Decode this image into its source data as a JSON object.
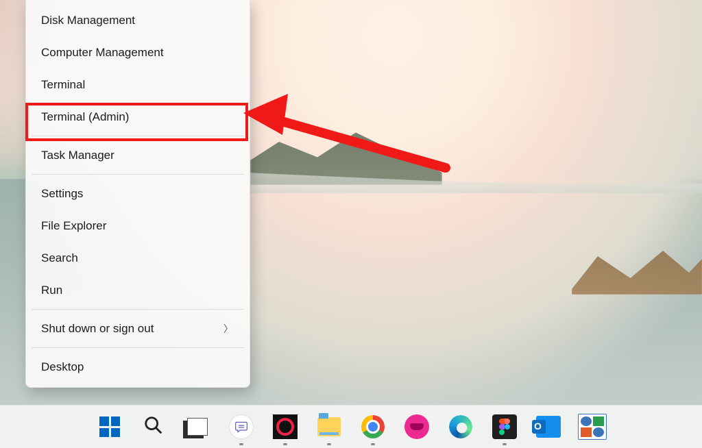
{
  "menu": {
    "items": [
      {
        "label": "Disk Management",
        "submenu": false,
        "highlighted": false,
        "sep_after": false
      },
      {
        "label": "Computer Management",
        "submenu": false,
        "highlighted": false,
        "sep_after": false
      },
      {
        "label": "Terminal",
        "submenu": false,
        "highlighted": false,
        "sep_after": false
      },
      {
        "label": "Terminal (Admin)",
        "submenu": false,
        "highlighted": true,
        "sep_after": true
      },
      {
        "label": "Task Manager",
        "submenu": false,
        "highlighted": false,
        "sep_after": true
      },
      {
        "label": "Settings",
        "submenu": false,
        "highlighted": false,
        "sep_after": false
      },
      {
        "label": "File Explorer",
        "submenu": false,
        "highlighted": false,
        "sep_after": false
      },
      {
        "label": "Search",
        "submenu": false,
        "highlighted": false,
        "sep_after": false
      },
      {
        "label": "Run",
        "submenu": false,
        "highlighted": false,
        "sep_after": true
      },
      {
        "label": "Shut down or sign out",
        "submenu": true,
        "highlighted": false,
        "sep_after": true
      },
      {
        "label": "Desktop",
        "submenu": false,
        "highlighted": false,
        "sep_after": false
      }
    ]
  },
  "annotation": {
    "highlighted_item_index": 3,
    "arrow_color": "#ef1a18"
  },
  "taskbar": {
    "items": [
      {
        "name": "start-button",
        "running": false
      },
      {
        "name": "search-button",
        "running": false
      },
      {
        "name": "task-view-button",
        "running": false
      },
      {
        "name": "chat-app",
        "running": true
      },
      {
        "name": "screen-recorder-app",
        "running": true
      },
      {
        "name": "file-explorer-app",
        "running": true
      },
      {
        "name": "chrome-app",
        "running": true
      },
      {
        "name": "media-app",
        "running": false
      },
      {
        "name": "edge-app",
        "running": false
      },
      {
        "name": "figma-app",
        "running": true
      },
      {
        "name": "outlook-app",
        "running": false
      },
      {
        "name": "control-panel-app",
        "running": false
      }
    ]
  }
}
